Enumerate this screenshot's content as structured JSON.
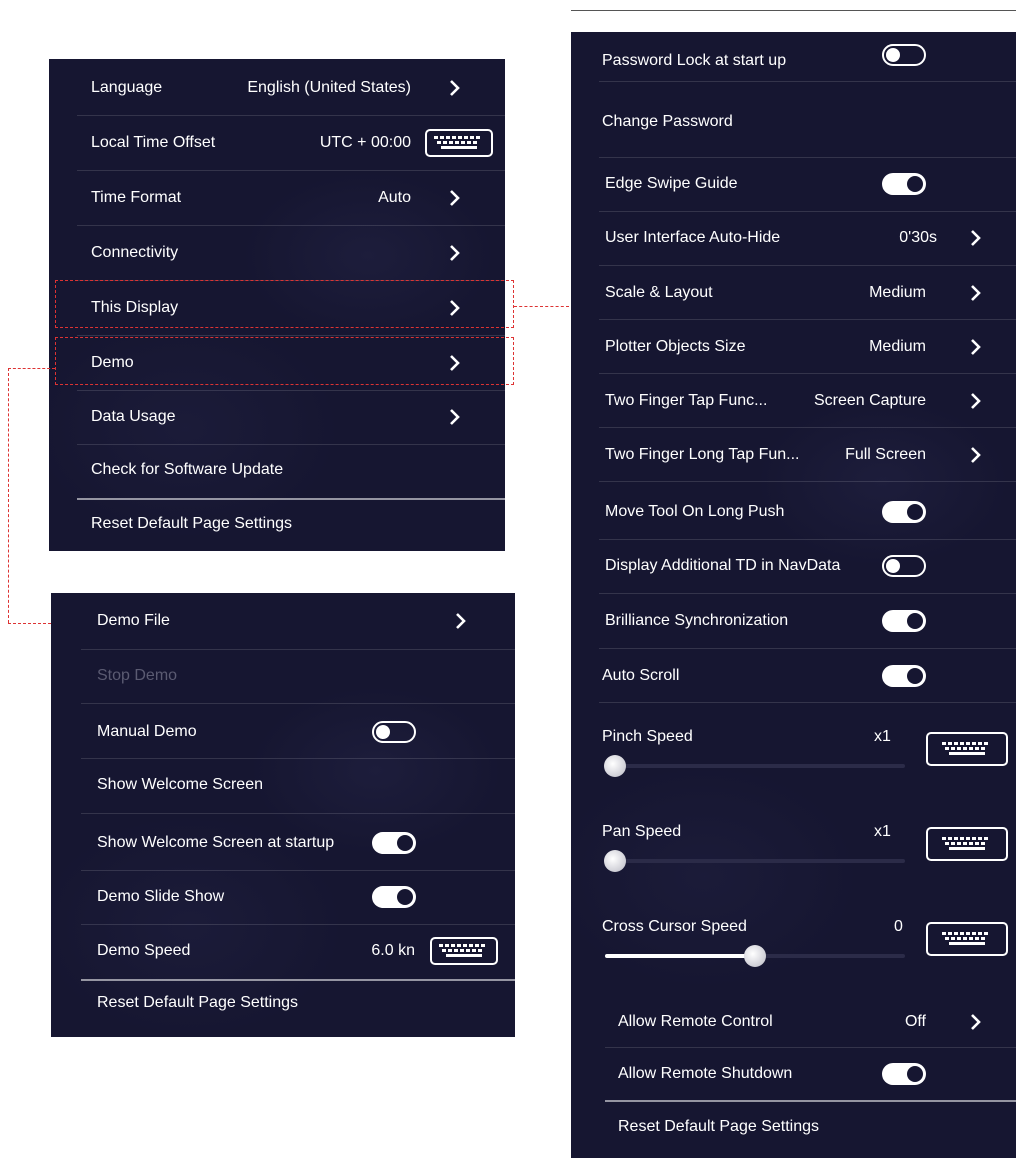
{
  "panel_general": {
    "rows": [
      {
        "label": "Language",
        "value": "English (United States)"
      },
      {
        "label": "Local Time Offset",
        "value": "UTC + 00:00"
      },
      {
        "label": "Time Format",
        "value": "Auto"
      },
      {
        "label": "Connectivity"
      },
      {
        "label": "This Display"
      },
      {
        "label": "Demo"
      },
      {
        "label": "Data Usage"
      },
      {
        "label": "Check for Software Update"
      },
      {
        "label": "Reset Default Page Settings"
      }
    ]
  },
  "panel_demo": {
    "rows": [
      {
        "label": "Demo File"
      },
      {
        "label": "Stop Demo",
        "disabled": true
      },
      {
        "label": "Manual Demo",
        "toggle": "off"
      },
      {
        "label": "Show Welcome Screen"
      },
      {
        "label": "Show Welcome Screen at startup",
        "toggle": "on"
      },
      {
        "label": "Demo Slide Show",
        "toggle": "on"
      },
      {
        "label": "Demo Speed",
        "value": "6.0 kn"
      },
      {
        "label": "Reset Default Page Settings"
      }
    ]
  },
  "panel_display": {
    "rows": [
      {
        "label": "Password Lock at start up",
        "toggle": "off"
      },
      {
        "label": "Change Password"
      },
      {
        "label": "Edge Swipe Guide",
        "toggle": "on"
      },
      {
        "label": "User Interface Auto-Hide",
        "value": "0'30s"
      },
      {
        "label": "Scale & Layout",
        "value": "Medium"
      },
      {
        "label": "Plotter Objects Size",
        "value": "Medium"
      },
      {
        "label": "Two Finger Tap Func...",
        "value": "Screen Capture"
      },
      {
        "label": "Two Finger Long Tap Fun...",
        "value": "Full Screen"
      },
      {
        "label": "Move Tool On Long Push",
        "toggle": "on"
      },
      {
        "label": "Display Additional TD in NavData",
        "toggle": "off"
      },
      {
        "label": "Brilliance Synchronization",
        "toggle": "on"
      },
      {
        "label": "Auto Scroll",
        "toggle": "on"
      }
    ],
    "sliders": [
      {
        "label": "Pinch Speed",
        "value": "x1",
        "level": 0
      },
      {
        "label": "Pan Speed",
        "value": "x1",
        "level": 0
      },
      {
        "label": "Cross Cursor Speed",
        "value": "0",
        "level": 0.5
      }
    ],
    "bottom_rows": [
      {
        "label": "Allow Remote Control",
        "value": "Off"
      },
      {
        "label": "Allow Remote Shutdown",
        "toggle": "on"
      },
      {
        "label": "Reset Default Page Settings"
      }
    ]
  },
  "icons": {
    "chevron": "chevron-right-icon",
    "keyboard": "keyboard-icon",
    "toggle": "toggle-switch",
    "slider": "slider-knob"
  },
  "colors": {
    "panel_bg": "#161631",
    "highlight": "#dd3333",
    "text": "#ffffff",
    "disabled_text": "#5b5b72"
  }
}
